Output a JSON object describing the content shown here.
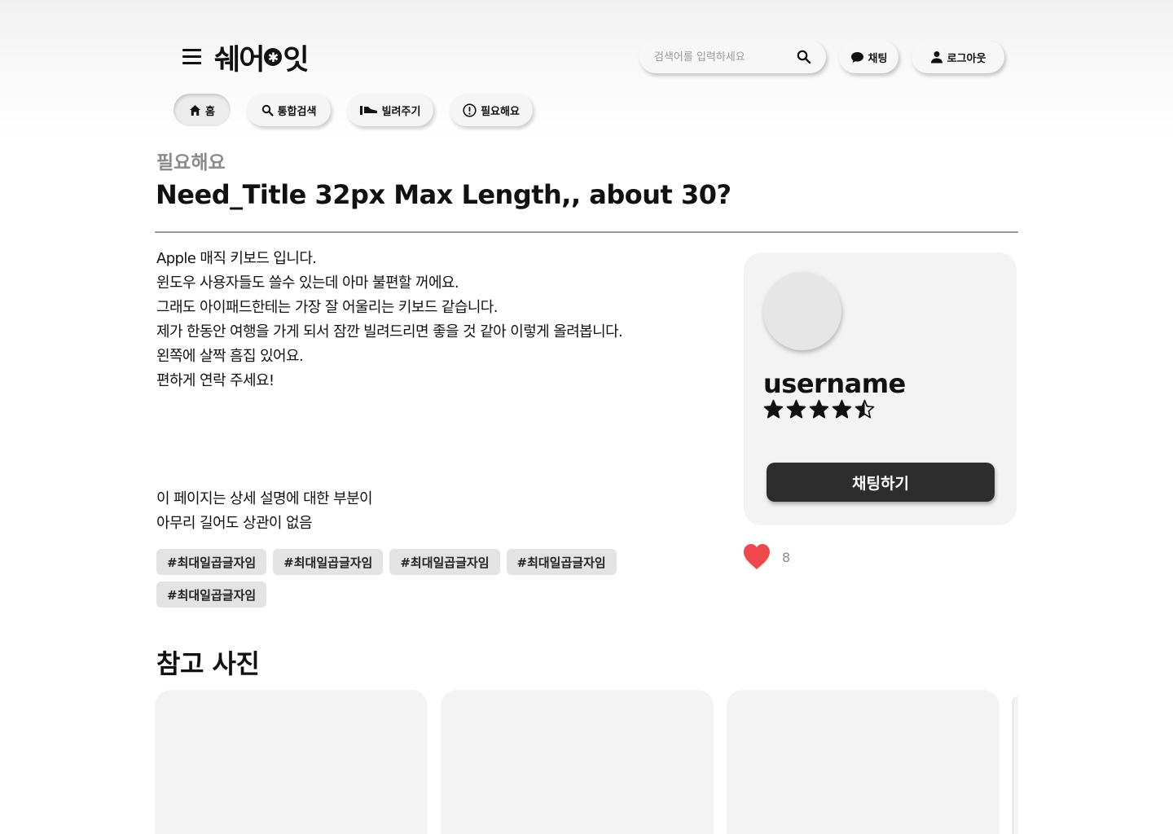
{
  "header": {
    "logo_text_left": "쉐어",
    "logo_text_right": "잇",
    "logo_star": "✱",
    "search_placeholder": "검색어를 입력하세요",
    "chat_label": "채팅",
    "logout_label": "로그아웃"
  },
  "nav": {
    "tabs": [
      {
        "label": "홈",
        "icon": "home-icon",
        "active": true
      },
      {
        "label": "통합검색",
        "icon": "search-icon",
        "active": false
      },
      {
        "label": "빌려주기",
        "icon": "lend-icon",
        "active": false
      },
      {
        "label": "필요해요",
        "icon": "alert-circle-icon",
        "active": false
      }
    ]
  },
  "post": {
    "category": "필요해요",
    "title": "Need_Title 32px Max Length,, about 30?",
    "description_lines": [
      "Apple 매직 키보드 입니다.",
      "윈도우 사용자들도 쓸수 있는데 아마 불편할 꺼에요.",
      "그래도 아이패드한테는 가장 잘 어울리는 키보드 같습니다.",
      "제가 한동안 여행을 가게 되서 잠깐 빌려드리면 좋을 것 같아 이렇게 올려봅니다.",
      "왼쪽에 살짝 흠집 있어요.",
      "편하게 연락 주세요!"
    ],
    "description_extra_lines": [
      "이 페이지는 상세 설명에 대한 부분이",
      "아무리 길어도 상관이 없음"
    ],
    "tags": [
      "#최대일곱글자임",
      "#최대일곱글자임",
      "#최대일곱글자임",
      "#최대일곱글자임",
      "#최대일곱글자임"
    ],
    "like_count": "8",
    "like_color": "#f0474b"
  },
  "profile": {
    "username": "username",
    "rating": 4.5,
    "rating_max": 5,
    "chat_button_label": "채팅하기"
  },
  "references": {
    "title": "참고 사진",
    "photo_count": 3
  }
}
